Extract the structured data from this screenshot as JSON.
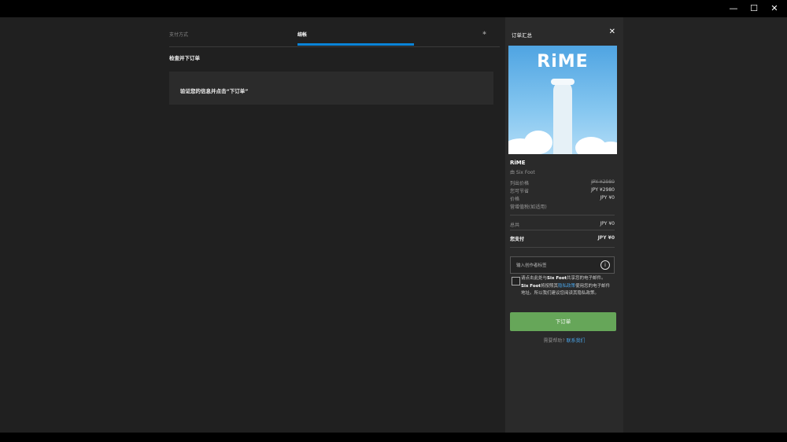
{
  "window": {
    "minimize": "—",
    "maximize": "☐",
    "close": "✕"
  },
  "steps": {
    "step1": "支付方式",
    "step2": "结帐",
    "step3": "✱"
  },
  "main": {
    "section_title": "检查并下订单",
    "verify_text": "验证您的信息并点击“下订单”"
  },
  "summary": {
    "title": "订单汇总",
    "close": "✕",
    "cover_logo": "RiME",
    "game_name": "RiME",
    "publisher": "由 Six Foot",
    "list_price_label": "列出价格",
    "list_price": "JPY ¥2980",
    "discount_label": "您可节省",
    "discount": "JPY ¥2980",
    "price_label": "价格",
    "price": "JPY ¥0",
    "tax_label": "营增值税(如适用)",
    "total_label": "总共",
    "total": "JPY ¥0",
    "pay_label": "您支付",
    "pay": "JPY ¥0",
    "code_placeholder": "输入创作者标签",
    "consent_1": "请点击此处与",
    "consent_brand1": "Six Foot",
    "consent_2": "共享您的电子邮件。",
    "consent_brand2": "Six Foot",
    "consent_3": "将按照其",
    "consent_link": "隐私政策",
    "consent_4": "使用您的电子邮件地址。所以我们建议您阅读其隐私政策。",
    "order_button": "下订单",
    "help_text": "需要帮助?",
    "help_link": "联系我们"
  }
}
